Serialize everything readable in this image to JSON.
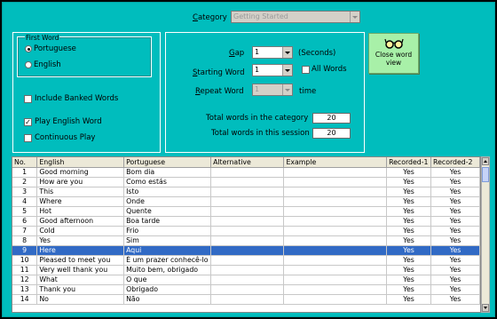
{
  "category": {
    "label": "Category",
    "value": "Getting Started"
  },
  "first_word": {
    "legend": "First Word",
    "options": [
      "Portuguese",
      "English"
    ],
    "selected": "Portuguese"
  },
  "checks": {
    "include_banked": {
      "label": "Include Banked Words",
      "checked": false
    },
    "play_english": {
      "label": "Play English Word",
      "checked": true
    },
    "continuous": {
      "label": "Continuous Play",
      "checked": false
    }
  },
  "session": {
    "gap_label": "Gap",
    "gap_value": "1",
    "gap_unit": "(Seconds)",
    "starting_label": "Starting Word",
    "starting_value": "1",
    "all_words_label": "All Words",
    "repeat_label": "Repeat Word",
    "repeat_value": "1",
    "repeat_unit": "time",
    "total_cat_label": "Total words in the category",
    "total_cat_value": "20",
    "total_sess_label": "Total words in this session",
    "total_sess_value": "20"
  },
  "close_button": {
    "line1": "Close word",
    "line2": "view"
  },
  "grid": {
    "columns": [
      "No.",
      "English",
      "Portuguese",
      "Alternative",
      "Example",
      "Recorded-1",
      "Recorded-2"
    ],
    "rows": [
      [
        "1",
        "Good morning",
        "Bom dia",
        "",
        "",
        "Yes",
        "Yes"
      ],
      [
        "2",
        "How are you",
        "Como estás",
        "",
        "",
        "Yes",
        "Yes"
      ],
      [
        "3",
        "This",
        "Isto",
        "",
        "",
        "Yes",
        "Yes"
      ],
      [
        "4",
        "Where",
        "Onde",
        "",
        "",
        "Yes",
        "Yes"
      ],
      [
        "5",
        "Hot",
        "Quente",
        "",
        "",
        "Yes",
        "Yes"
      ],
      [
        "6",
        "Good afternoon",
        "Boa tarde",
        "",
        "",
        "Yes",
        "Yes"
      ],
      [
        "7",
        "Cold",
        "Frio",
        "",
        "",
        "Yes",
        "Yes"
      ],
      [
        "8",
        "Yes",
        "Sim",
        "",
        "",
        "Yes",
        "Yes"
      ],
      [
        "9",
        "Here",
        "Aqui",
        "",
        "",
        "Yes",
        "Yes"
      ],
      [
        "10",
        "Pleased to meet you",
        "É um prazer conhecê-lo",
        "",
        "",
        "Yes",
        "Yes"
      ],
      [
        "11",
        "Very well thank you",
        "Muito bem, obrigado",
        "",
        "",
        "Yes",
        "Yes"
      ],
      [
        "12",
        "What",
        "O que",
        "",
        "",
        "Yes",
        "Yes"
      ],
      [
        "13",
        "Thank you",
        "Obrigado",
        "",
        "",
        "Yes",
        "Yes"
      ],
      [
        "14",
        "No",
        "Não",
        "",
        "",
        "Yes",
        "Yes"
      ]
    ],
    "selected_row": "9"
  }
}
